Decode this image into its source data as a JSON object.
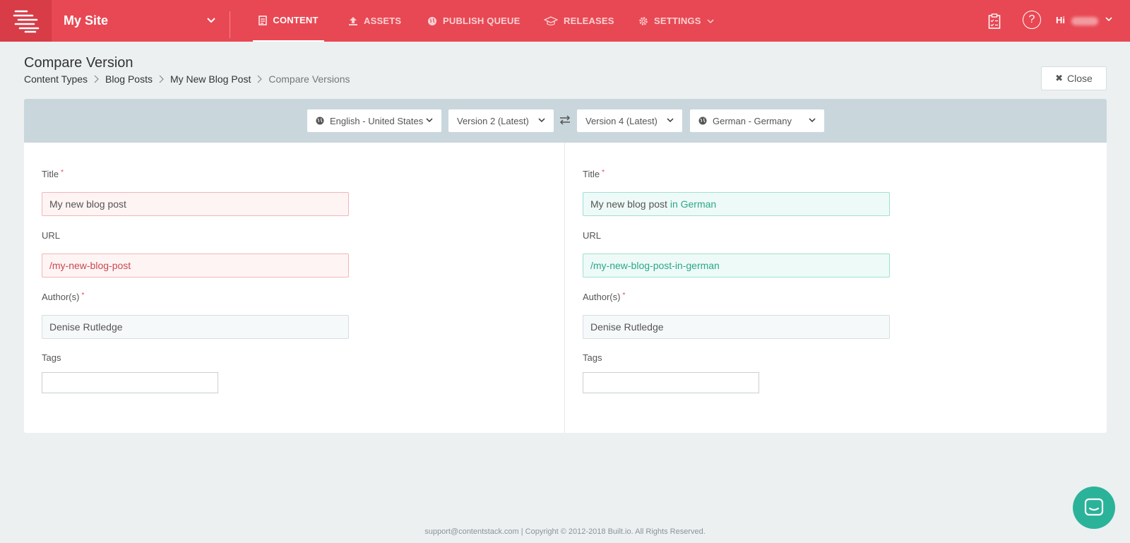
{
  "topbar": {
    "site_name": "My Site",
    "nav": [
      {
        "label": "CONTENT",
        "icon": "document-icon",
        "active": true
      },
      {
        "label": "ASSETS",
        "icon": "upload-icon",
        "active": false
      },
      {
        "label": "PUBLISH QUEUE",
        "icon": "globe-icon",
        "active": false
      },
      {
        "label": "RELEASES",
        "icon": "release-icon",
        "active": false
      },
      {
        "label": "SETTINGS",
        "icon": "gear-icon",
        "active": false
      }
    ],
    "help_glyph": "?",
    "greeting": "Hi",
    "accent_color": "#e84853"
  },
  "header": {
    "title": "Compare Version",
    "breadcrumb": [
      "Content Types",
      "Blog Posts",
      "My New Blog Post",
      "Compare Versions"
    ],
    "close_label": "Close"
  },
  "compare": {
    "left_locale": "English - United States",
    "left_version": "Version 2 (Latest)",
    "right_version": "Version 4 (Latest)",
    "right_locale": "German - Germany"
  },
  "left": {
    "title_label": "Title",
    "title_value": "My new blog post",
    "url_label": "URL",
    "url_value": "/my-new-blog-post",
    "author_label": "Author(s)",
    "author_value": "Denise Rutledge",
    "tags_label": "Tags"
  },
  "right": {
    "title_label": "Title",
    "title_value_base": "My new blog post",
    "title_value_added": " in German",
    "url_label": "URL",
    "url_value": "/my-new-blog-post-in-german",
    "author_label": "Author(s)",
    "author_value": "Denise Rutledge",
    "tags_label": "Tags"
  },
  "required_mark": "*",
  "footer": {
    "text": "support@contentstack.com | Copyright © 2012-2018 Built.io. All Rights Reserved."
  },
  "colors": {
    "removed_bg": "#fff4f4",
    "added_bg": "#eefaf7",
    "added_text": "#2aa789",
    "chat_button": "#2bb39a"
  }
}
